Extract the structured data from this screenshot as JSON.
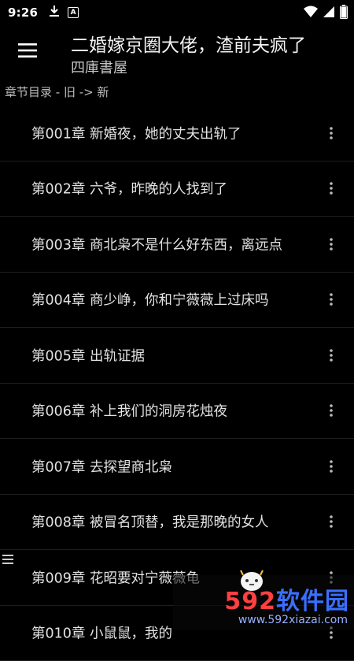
{
  "status_bar": {
    "time": "9:26",
    "badge_letter": "A",
    "icons": [
      "download-icon",
      "a-badge-icon",
      "wifi-icon",
      "signal-icon",
      "battery-icon"
    ]
  },
  "app_bar": {
    "title": "二婚嫁京圈大佬，渣前夫疯了",
    "subtitle": "四庫書屋",
    "menu_icon": "hamburger-menu-icon"
  },
  "section_header": "章节目录 - 旧 -> 新",
  "chapters": [
    {
      "label": "第001章 新婚夜，她的丈夫出轨了"
    },
    {
      "label": "第002章 六爷，昨晚的人找到了"
    },
    {
      "label": "第003章 商北枭不是什么好东西，离远点"
    },
    {
      "label": "第004章 商少峥，你和宁薇薇上过床吗"
    },
    {
      "label": "第005章 出轨证据"
    },
    {
      "label": "第006章 补上我们的洞房花烛夜"
    },
    {
      "label": "第007章 去探望商北枭"
    },
    {
      "label": "第008章 被冒名顶替，我是那晚的女人"
    },
    {
      "label": "第009章 花昭要对宁薇薇龟"
    },
    {
      "label": "第010章 小鼠鼠，我的"
    }
  ],
  "watermark": {
    "logo_num": "592",
    "logo_cn": "软件园",
    "url": "www.592xiazai.com"
  },
  "colors": {
    "background": "#000000",
    "text_primary": "#e2e2e2",
    "divider": "#1e1e1e",
    "watermark_red": "#ff4040",
    "watermark_blue": "#3a6fff"
  }
}
